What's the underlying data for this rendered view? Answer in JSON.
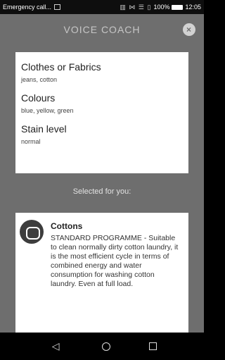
{
  "statusbar": {
    "notification": "Emergency call...",
    "battery": "100%",
    "time": "12:05"
  },
  "appbar": {
    "title": "VOICE COACH"
  },
  "selections": [
    {
      "label": "Clothes or Fabrics",
      "value": "jeans, cotton"
    },
    {
      "label": "Colours",
      "value": "blue, yellow, green"
    },
    {
      "label": "Stain level",
      "value": "normal"
    }
  ],
  "section": {
    "title": "Selected for you:"
  },
  "program": {
    "name": "Cottons",
    "description": "STANDARD PROGRAMME - Suitable to clean normally dirty cotton laundry, it is the most efficient cycle in terms of combined energy and water consumption for washing cotton laundry. Even at full load."
  },
  "icons": {
    "close": "close-icon",
    "program": "cottons-program-icon",
    "back": "back-icon",
    "home": "home-icon",
    "recents": "recents-icon"
  }
}
